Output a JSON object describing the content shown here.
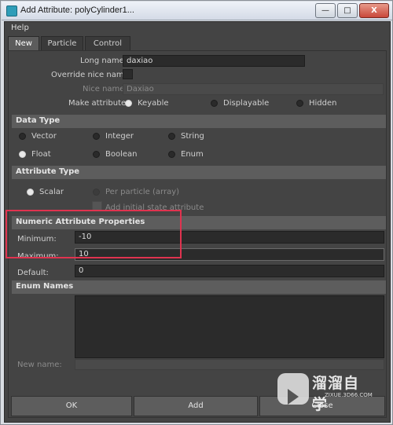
{
  "window": {
    "title": "Add Attribute: polyCylinder1...",
    "minimize_label": "—",
    "maximize_label": "□",
    "close_label": "X"
  },
  "menu": {
    "help": "Help"
  },
  "tabs": [
    {
      "label": "New",
      "active": true
    },
    {
      "label": "Particle",
      "active": false
    },
    {
      "label": "Control",
      "active": false
    }
  ],
  "names": {
    "long_name_label": "Long name:",
    "long_name_value": "daxiao",
    "override_label": "Override nice name:",
    "nice_name_label": "Nice name:",
    "nice_name_value": "Daxiao"
  },
  "make_attribute": {
    "label": "Make attribute:",
    "options": [
      "Keyable",
      "Displayable",
      "Hidden"
    ],
    "selected": "Keyable"
  },
  "data_type": {
    "header": "Data Type",
    "options": [
      "Vector",
      "Integer",
      "String",
      "Float",
      "Boolean",
      "Enum"
    ],
    "selected": "Float"
  },
  "attribute_type": {
    "header": "Attribute Type",
    "scalar": "Scalar",
    "per_particle": "Per particle (array)",
    "add_initial": "Add initial state attribute"
  },
  "numeric": {
    "header": "Numeric Attribute Properties",
    "minimum_label": "Minimum:",
    "minimum_value": "-10",
    "maximum_label": "Maximum:",
    "maximum_value": "10",
    "default_label": "Default:",
    "default_value": "0"
  },
  "enum": {
    "header": "Enum Names",
    "new_name_label": "New name:"
  },
  "buttons": {
    "ok": "OK",
    "add": "Add",
    "close": "Close"
  },
  "watermark": {
    "text": "溜溜自学",
    "url": "ZIXUE.3D66.COM"
  },
  "colors": {
    "highlight": "#e0334f",
    "panel": "#444444",
    "section": "#5d5d5d"
  }
}
